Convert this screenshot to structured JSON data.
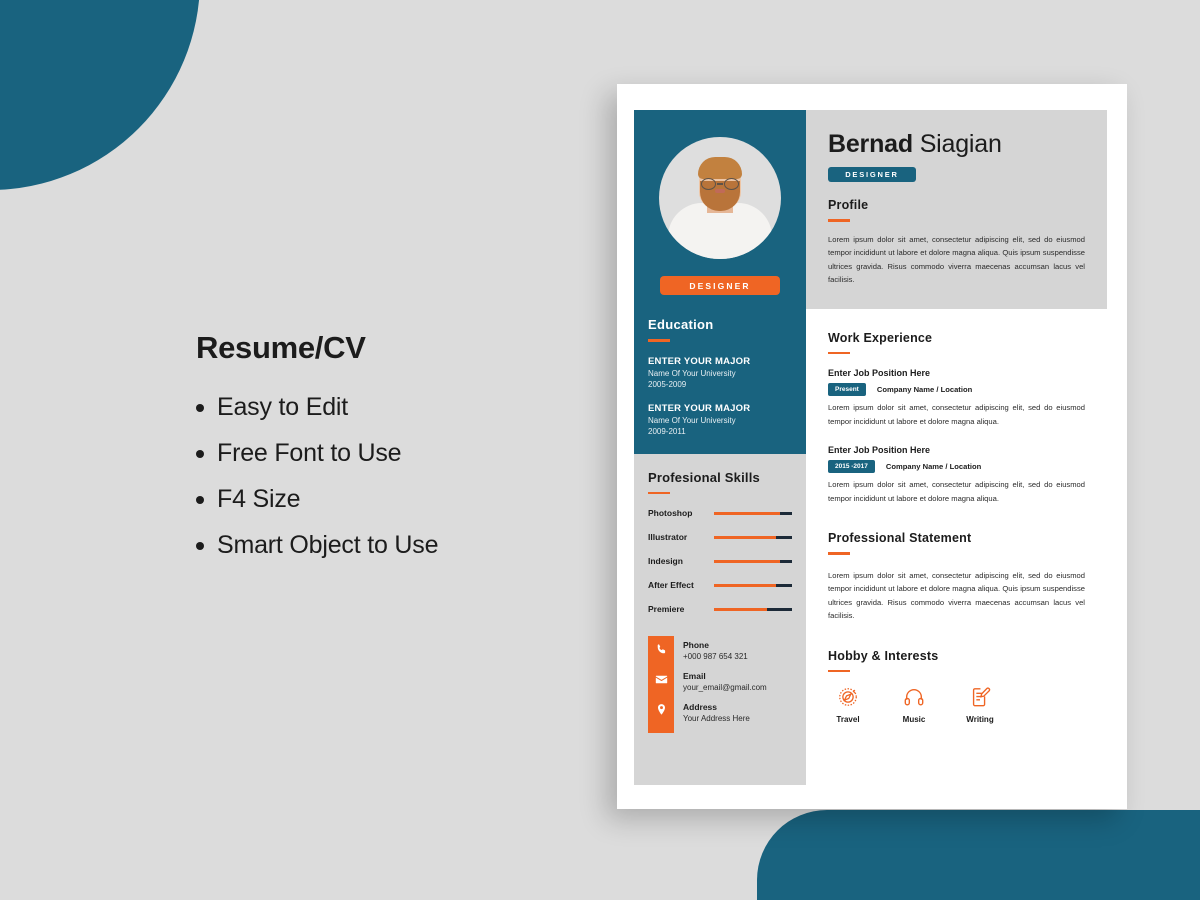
{
  "theme": {
    "teal": "#19637f",
    "orange": "#ef6524",
    "grey": "#d5d5d5",
    "page_bg": "#dcdcdc",
    "dark": "#1c2a38"
  },
  "promo": {
    "title": "Resume/CV",
    "features": [
      "Easy to Edit",
      "Free Font to Use",
      "F4 Size",
      "Smart Object to Use"
    ]
  },
  "resume": {
    "header": {
      "first_name": "Bernad",
      "last_name": "Siagian",
      "role_badge": "DESIGNER",
      "photo_alt": "portrait-photo"
    },
    "sidebar": {
      "role_badge": "DESIGNER",
      "education": {
        "title": "Education",
        "entries": [
          {
            "major": "ENTER YOUR MAJOR",
            "university": "Name Of Your University",
            "years": "2005-2009"
          },
          {
            "major": "ENTER YOUR MAJOR",
            "university": "Name Of Your University",
            "years": "2009-2011"
          }
        ]
      },
      "skills": {
        "title": "Profesional Skills",
        "items": [
          {
            "name": "Photoshop",
            "level": 85
          },
          {
            "name": "Illustrator",
            "level": 80
          },
          {
            "name": "Indesign",
            "level": 85
          },
          {
            "name": "After Effect",
            "level": 80
          },
          {
            "name": "Premiere",
            "level": 68
          }
        ]
      },
      "contact": [
        {
          "icon": "phone-icon",
          "label": "Phone",
          "value": "+000 987 654 321"
        },
        {
          "icon": "email-icon",
          "label": "Email",
          "value": "your_email@gmail.com"
        },
        {
          "icon": "location-icon",
          "label": "Address",
          "value": "Your Address Here"
        }
      ]
    },
    "profile": {
      "title": "Profile",
      "text": "Lorem ipsum dolor sit amet, consectetur adipiscing elit, sed do eiusmod tempor incididunt ut labore et dolore magna aliqua. Quis ipsum suspendisse ultrices gravida. Risus commodo viverra maecenas accumsan lacus vel facilisis."
    },
    "work": {
      "title": "Work Experience",
      "jobs": [
        {
          "position": "Enter Job Position Here",
          "badge": "Present",
          "company": "Company Name / Location",
          "text": "Lorem ipsum dolor sit amet, consectetur adipiscing elit, sed do eiusmod tempor incididunt ut labore et dolore magna aliqua."
        },
        {
          "position": "Enter Job Position Here",
          "badge": "2015 -2017",
          "company": "Company Name / Location",
          "text": "Lorem ipsum dolor sit amet, consectetur adipiscing elit, sed do eiusmod tempor incididunt ut labore et dolore magna aliqua."
        }
      ]
    },
    "statement": {
      "title": "Professional Statement",
      "text": "Lorem ipsum dolor sit amet, consectetur adipiscing elit, sed do eiusmod tempor incididunt ut labore et dolore magna aliqua. Quis ipsum suspendisse ultrices gravida. Risus commodo viverra maecenas accumsan lacus vel facilisis."
    },
    "hobby": {
      "title": "Hobby & Interests",
      "items": [
        {
          "icon": "compass-icon",
          "label": "Travel"
        },
        {
          "icon": "headphones-icon",
          "label": "Music"
        },
        {
          "icon": "writing-icon",
          "label": "Writing"
        }
      ]
    }
  }
}
